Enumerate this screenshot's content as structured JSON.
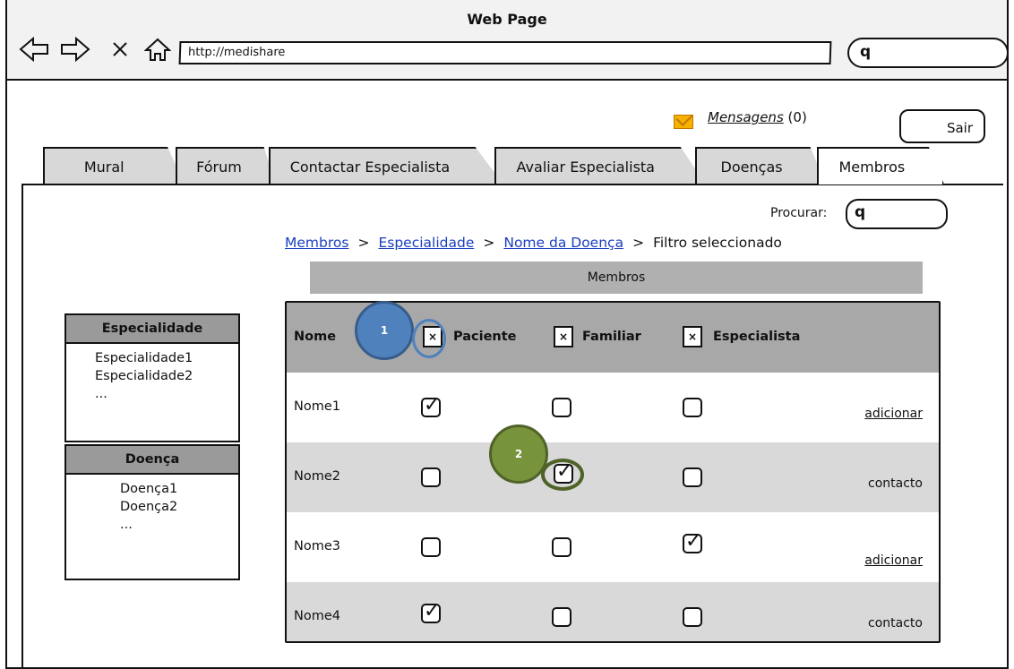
{
  "window": {
    "title": "Web Page",
    "url": "http://medishare"
  },
  "header": {
    "messages_label": "Mensagens",
    "messages_count": "(0)",
    "logout_label": "Sair"
  },
  "tabs": [
    {
      "label": "Mural"
    },
    {
      "label": "Fórum"
    },
    {
      "label": "Contactar Especialista"
    },
    {
      "label": "Avaliar Especialista"
    },
    {
      "label": "Doenças"
    },
    {
      "label": "Membros",
      "active": true
    }
  ],
  "search": {
    "label": "Procurar:"
  },
  "breadcrumb": {
    "items": [
      "Membros",
      "Especialidade",
      "Nome da Doença"
    ],
    "current": "Filtro seleccionado",
    "separator": ">"
  },
  "section_title": "Membros",
  "sidebar": {
    "specialty": {
      "title": "Especialidade",
      "items": [
        "Especialidade1",
        "Especialidade2",
        "..."
      ]
    },
    "disease": {
      "title": "Doença",
      "items": [
        "Doença1",
        "Doença2",
        "..."
      ]
    }
  },
  "table": {
    "headers": {
      "name": "Nome",
      "patient": "Paciente",
      "family": "Familiar",
      "specialist": "Especialista",
      "filter_mark": "×"
    },
    "rows": [
      {
        "name": "Nome1",
        "patient": true,
        "family": false,
        "specialist": false,
        "action": "adicionar"
      },
      {
        "name": "Nome2",
        "patient": false,
        "family": true,
        "specialist": false,
        "action": "contacto"
      },
      {
        "name": "Nome3",
        "patient": false,
        "family": false,
        "specialist": true,
        "action": "adicionar"
      },
      {
        "name": "Nome4",
        "patient": true,
        "family": false,
        "specialist": false,
        "action": "contacto"
      }
    ]
  },
  "annotations": [
    {
      "label": "1",
      "color": "#4f81bd"
    },
    {
      "label": "2",
      "color": "#77933c"
    }
  ]
}
